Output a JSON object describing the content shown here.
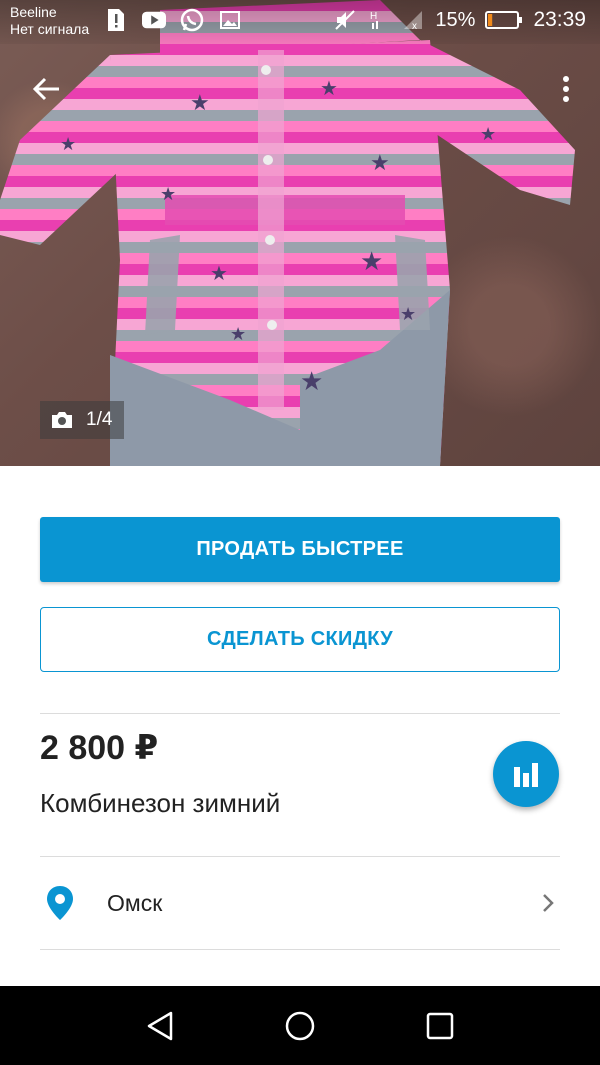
{
  "status_bar": {
    "carrier": "Beeline",
    "signal_status": "Нет сигнала",
    "battery_percent": "15%",
    "battery_level": 0.15,
    "time": "23:39",
    "network_letter": "H",
    "icons": [
      "sim-alert-icon",
      "youtube-icon",
      "whatsapp-icon",
      "gallery-icon",
      "mute-icon",
      "signal-icon",
      "battery-icon"
    ]
  },
  "photo": {
    "counter": "1/4"
  },
  "actions": {
    "sell_faster_label": "ПРОДАТЬ БЫСТРЕЕ",
    "make_discount_label": "СДЕЛАТЬ СКИДКУ"
  },
  "listing": {
    "price": "2 800 ₽",
    "title": "Комбинезон зимний",
    "location": "Омск"
  },
  "colors": {
    "accent": "#0a95d2",
    "text": "#222222",
    "divider": "#dcdcdc"
  }
}
